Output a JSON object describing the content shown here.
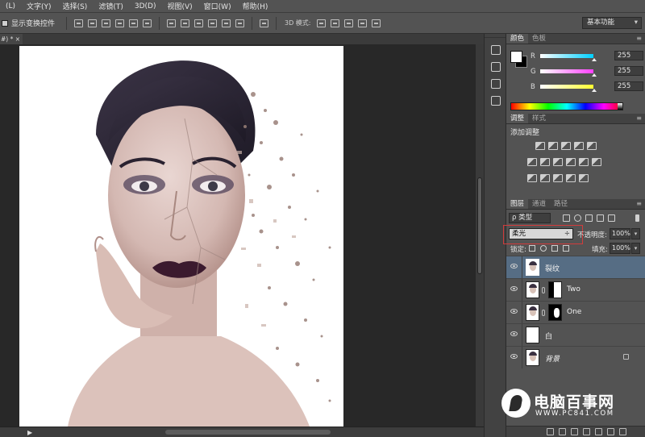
{
  "menu": [
    "(L)",
    "文字(Y)",
    "选择(S)",
    "滤镜(T)",
    "3D(D)",
    "视图(V)",
    "窗口(W)",
    "帮助(H)"
  ],
  "options": {
    "show_transform": "显示变换控件",
    "mode_3d": "3D 模式:",
    "workspace": "基本功能"
  },
  "doc_tab": "#) * ×",
  "color_panel": {
    "tabs": [
      "颜色",
      "色板"
    ],
    "channels": [
      {
        "label": "R",
        "value": "255",
        "color": "#00d0ff"
      },
      {
        "label": "G",
        "value": "255",
        "color": "#ff40ff"
      },
      {
        "label": "B",
        "value": "255",
        "color": "#ffff30"
      }
    ]
  },
  "adjust_panel": {
    "tabs": [
      "调整",
      "样式"
    ],
    "title": "添加调整"
  },
  "layers_panel": {
    "tabs": [
      "图层",
      "通道",
      "路径"
    ],
    "filter": "ρ 类型",
    "blend_mode": "柔光",
    "opacity_label": "不透明度:",
    "opacity": "100%",
    "lock_label": "锁定:",
    "fill_label": "填充:",
    "fill": "100%",
    "layers": [
      {
        "name": "裂纹",
        "selected": true
      },
      {
        "name": "Two",
        "selected": false
      },
      {
        "name": "One",
        "selected": false
      },
      {
        "name": "白",
        "selected": false
      },
      {
        "name": "背景",
        "selected": false
      }
    ]
  },
  "watermark": {
    "title": "电脑百事网",
    "url": "WWW.PC841.COM"
  }
}
